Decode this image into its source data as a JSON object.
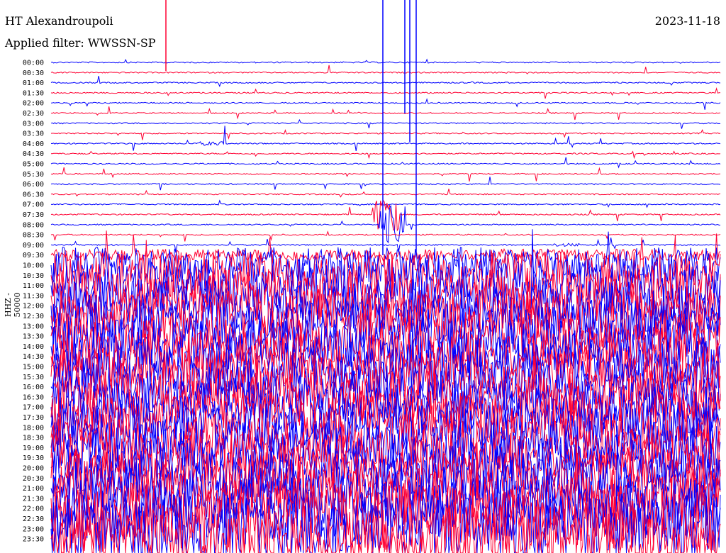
{
  "header": {
    "station": "HT Alexandroupoli",
    "date": "2023-11-18",
    "filter": "Applied filter: WWSSN-SP",
    "channel": "HHZ - 50000"
  },
  "colors": {
    "odd": "#0000ff",
    "even": "#ff0033",
    "background": "#ffffff",
    "text": "#000000"
  },
  "chart_data": {
    "type": "line",
    "title": "HT Alexandroupoli",
    "subtitle": "Applied filter: WWSSN-SP",
    "ylabel": "HHZ - 50000",
    "xlabel": "",
    "row_labels": [
      "00:00",
      "00:30",
      "01:00",
      "01:30",
      "02:00",
      "02:30",
      "03:00",
      "03:30",
      "04:00",
      "04:30",
      "05:00",
      "05:30",
      "06:00",
      "06:30",
      "07:00",
      "07:30",
      "08:00",
      "08:30",
      "09:00",
      "09:30",
      "10:00",
      "10:30",
      "11:00",
      "11:30",
      "12:00",
      "12:30",
      "13:00",
      "13:30",
      "14:00",
      "14:30",
      "15:00",
      "15:30",
      "16:00",
      "16:30",
      "17:00",
      "17:30",
      "18:00",
      "18:30",
      "19:00",
      "19:30",
      "20:00",
      "20:30",
      "21:00",
      "21:30",
      "22:00",
      "22:30",
      "23:00",
      "23:30"
    ],
    "series_colors": [
      "#0000ff",
      "#ff0033"
    ],
    "noise_level": [
      1,
      1,
      1,
      1,
      1,
      1,
      1,
      1,
      1,
      1,
      1,
      1,
      1,
      1,
      1,
      1,
      1,
      1,
      1,
      2,
      6,
      8,
      9,
      9,
      9,
      9,
      9,
      9,
      9,
      9,
      9,
      9,
      9,
      9,
      9,
      9,
      9,
      9,
      9,
      9,
      9,
      9,
      10,
      10,
      11,
      12,
      12,
      12
    ],
    "events": [
      {
        "row": 8,
        "pos": 0.24,
        "amp": 1.0
      },
      {
        "row": 18,
        "pos": 0.77,
        "amp": 0.8
      },
      {
        "row": 15,
        "pos": 0.5,
        "amp": 9.0
      },
      {
        "row": 16,
        "pos": 0.51,
        "amp": 10.0
      }
    ]
  }
}
